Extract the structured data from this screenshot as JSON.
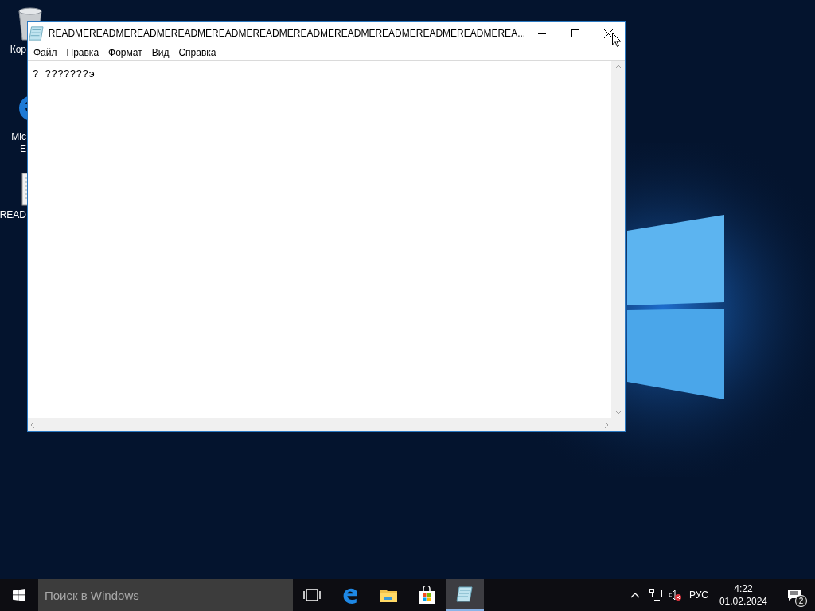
{
  "desktop": {
    "icons": [
      {
        "kind": "bin",
        "label_lines": [
          "Кор"
        ]
      },
      {
        "kind": "edge",
        "label_lines": [
          "Mic",
          "E"
        ]
      },
      {
        "kind": "doc",
        "label_lines": [
          "READ"
        ]
      }
    ]
  },
  "window": {
    "title": "READMEREADMEREADMEREADMEREADMEREADMEREADMEREADMEREADMEREADMEREADMEREA...",
    "menu": [
      "Файл",
      "Правка",
      "Формат",
      "Вид",
      "Справка"
    ],
    "text": "? ???????э"
  },
  "taskbar": {
    "search": {
      "placeholder": "Поиск в Windows"
    },
    "apps": [
      {
        "kind": "taskview",
        "selected": false
      },
      {
        "kind": "edge",
        "selected": false
      },
      {
        "kind": "explorer",
        "selected": false
      },
      {
        "kind": "store",
        "selected": false
      },
      {
        "kind": "notepad",
        "selected": true
      }
    ],
    "language": "РУС",
    "time": "4:22",
    "date": "01.02.2024",
    "notifications": "2"
  }
}
